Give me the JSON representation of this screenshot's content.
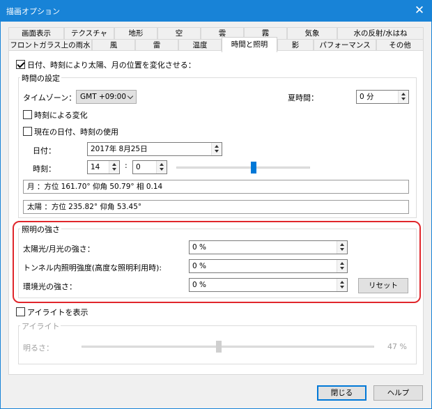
{
  "window": {
    "title": "描画オプション",
    "close_glyph": "✕"
  },
  "tabs_row1": [
    "画面表示",
    "テクスチャ",
    "地形",
    "空",
    "雲",
    "霧",
    "気象",
    "水の反射/水はね"
  ],
  "tabs_row2": [
    "フロントガラス上の雨水",
    "風",
    "雷",
    "温度",
    "時間と照明",
    "影",
    "パフォーマンス",
    "その他"
  ],
  "active_tab": "時間と照明",
  "main_checkbox": {
    "label": "日付、時刻により太陽、月の位置を変化させる：",
    "checked": true
  },
  "time_settings": {
    "title": "時間の設定",
    "timezone_label": "タイムゾーン：",
    "timezone_value": "GMT +09:00",
    "dst_label": "夏時間：",
    "dst_value": "0 分",
    "change_by_time": {
      "label": "時刻による変化",
      "checked": false
    },
    "use_current": {
      "label": "現在の日付、時刻の使用",
      "checked": false
    },
    "date_label": "日付：",
    "date_value": "2017年  8月25日",
    "time_label": "時刻：",
    "hour_value": "14",
    "colon": ":",
    "minute_value": "0",
    "time_slider_fraction": 0.58,
    "moon_info": "月    ：方位 161.70°    仰角 50.79°    相 0.14",
    "sun_info": "太陽    ：方位 235.82°    仰角 53.45°"
  },
  "lighting": {
    "title": "照明の強さ",
    "sun_moon_label": "太陽光/月光の強さ：",
    "sun_moon_value": "0 %",
    "tunnel_label": "トンネル内照明強度(高度な照明利用時):",
    "tunnel_value": "0 %",
    "ambient_label": "環境光の強さ：",
    "ambient_value": "0 %",
    "reset_label": "リセット"
  },
  "highlight_checkbox": {
    "label": "アイライトを表示",
    "checked": false
  },
  "highlight_group": {
    "title": "アイライト",
    "brightness_label": "明るさ：",
    "brightness_value": "47 %",
    "brightness_fraction": 0.47
  },
  "buttons": {
    "close": "閉じる",
    "help": "ヘルプ"
  },
  "colors": {
    "titlebar": "#1883d7",
    "accent": "#0078d7",
    "highlight_border": "#e0262b"
  }
}
